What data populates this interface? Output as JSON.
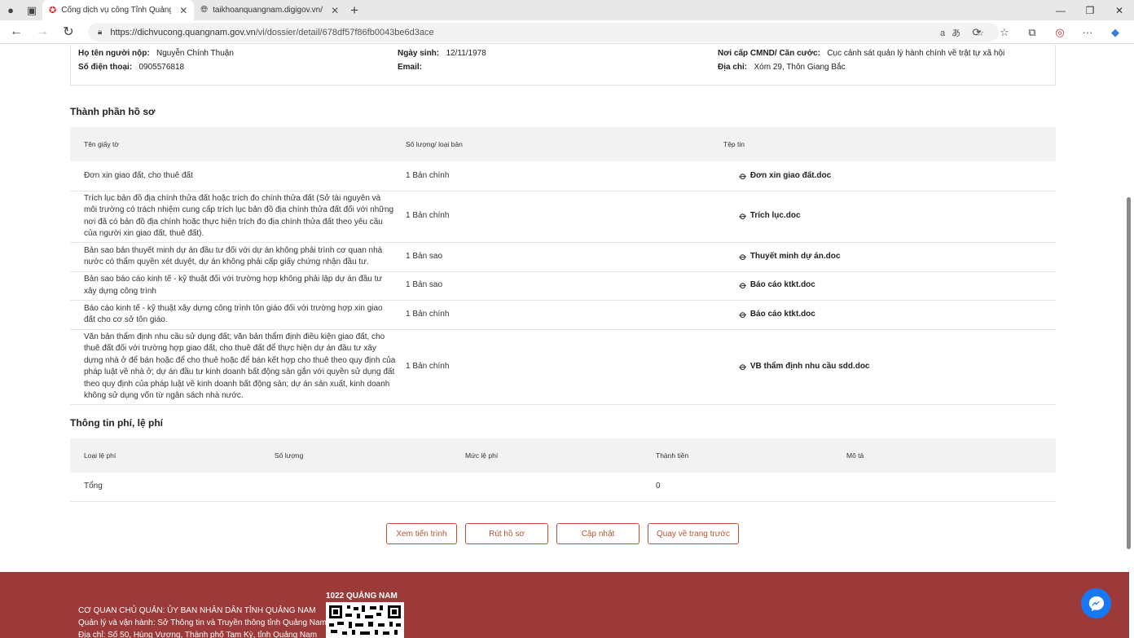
{
  "browser": {
    "tabs": [
      {
        "title": "Cổng dịch vụ công Tỉnh Quảng Nam",
        "active": true
      },
      {
        "title": "taikhoanquangnam.digigov.vn/vi/",
        "active": false
      }
    ],
    "url_host": "https://dichvucong.quangnam.gov.vn",
    "url_path": "/vi/dossier/detail/678df57f86fb0043be6d3ace"
  },
  "applicant": {
    "name_label": "Họ tên người nộp:",
    "name": "Nguyễn Chính Thuận",
    "phone_label": "Số điện thoại:",
    "phone": "0905576818",
    "dob_label": "Ngày sinh:",
    "dob": "12/11/1978",
    "email_label": "Email:",
    "email": "",
    "issuer_label": "Nơi cấp CMND/ Căn cước:",
    "issuer": "Cục cảnh sát quản lý hành chính về trật tự xã hội",
    "address_label": "Địa chỉ:",
    "address": "Xóm 29, Thôn Giang Bắc"
  },
  "documents": {
    "title": "Thành phần hồ sơ",
    "headers": [
      "Tên giấy tờ",
      "Số lượng/ loại bản",
      "Tệp tin"
    ],
    "rows": [
      {
        "name": "Đơn xin giao đất, cho thuê đất",
        "qty": "1 Bản chính",
        "file": "Đơn xin giao đất.doc"
      },
      {
        "name": "Trích lục bản đồ địa chính thửa đất hoặc trích đo chính thửa đất (Sở tài nguyên và môi trường có trách nhiệm cung cấp trích lục bản đồ địa chính thửa đất đối với những nơi đã có bản đồ địa chính hoặc thực hiện trích đo địa chính thửa đất theo yêu cầu của người xin giao đất, thuê đất).",
        "qty": "1 Bản chính",
        "file": "Trích lục.doc"
      },
      {
        "name": "Bản sao bản thuyết minh dự án đầu tư đối với dự án không phải trình cơ quan nhà nước có thẩm quyền xét duyệt, dự án không phải cấp giấy chứng nhận đầu tư.",
        "qty": "1 Bản sao",
        "file": "Thuyết minh dự án.doc"
      },
      {
        "name": "Bản sao báo cáo kinh tế - kỹ thuật đối với trường hợp không phải lập dự án đầu tư xây dựng công trình",
        "qty": "1 Bản sao",
        "file": "Báo cáo ktkt.doc"
      },
      {
        "name": "Báo cáo kinh tế - kỹ thuật xây dựng công trình tôn giáo đối với trường hợp xin giao đất cho cơ sở tôn giáo.",
        "qty": "1 Bản chính",
        "file": "Báo cáo ktkt.doc"
      },
      {
        "name": "Văn bản thẩm định nhu cầu sử dụng đất; văn bản thẩm định điều kiện giao đất, cho thuê đất đối với trường hợp giao đất, cho thuê đất để thực hiện dự án đầu tư xây dựng nhà ở để bán hoặc để cho thuê hoặc để bán kết hợp cho thuê theo quy định của pháp luật về nhà ở; dự án đầu tư kinh doanh bất động sản gắn với quyền sử dụng đất theo quy định của pháp luật về kinh doanh bất động sản; dự án sản xuất, kinh doanh không sử dụng vốn từ ngân sách nhà nước.",
        "qty": "1 Bản chính",
        "file": "VB thẩm định nhu cầu sdd.doc"
      }
    ]
  },
  "fees": {
    "title": "Thông tin phí, lệ phí",
    "headers": [
      "Loại lệ phí",
      "Số lượng",
      "Mức lệ phí",
      "Thành tiền",
      "Mô tả"
    ],
    "total_label": "Tổng",
    "total_value": "0"
  },
  "actions": {
    "view_progress": "Xem tiến trình",
    "withdraw": "Rút hồ sơ",
    "update": "Cập nhật",
    "back": "Quay về trang trước"
  },
  "footer": {
    "agency": "CƠ QUAN CHỦ QUẢN: ỦY BAN NHÂN DÂN TỈNH QUẢNG NAM",
    "operator": "Quản lý và vận hành: Sở Thông tin và Truyền thông tỉnh Quảng Nam",
    "address": "Địa chỉ: Số 50, Hùng Vương, Thành phố Tam Kỳ, tỉnh Quảng Nam",
    "hotline": "1022 QUẢNG NAM"
  },
  "colors": {
    "accent": "#b8532f",
    "footer_bg": "#9b3a39",
    "header_bg": "#f2f2f2",
    "messenger": "#1877f2"
  }
}
